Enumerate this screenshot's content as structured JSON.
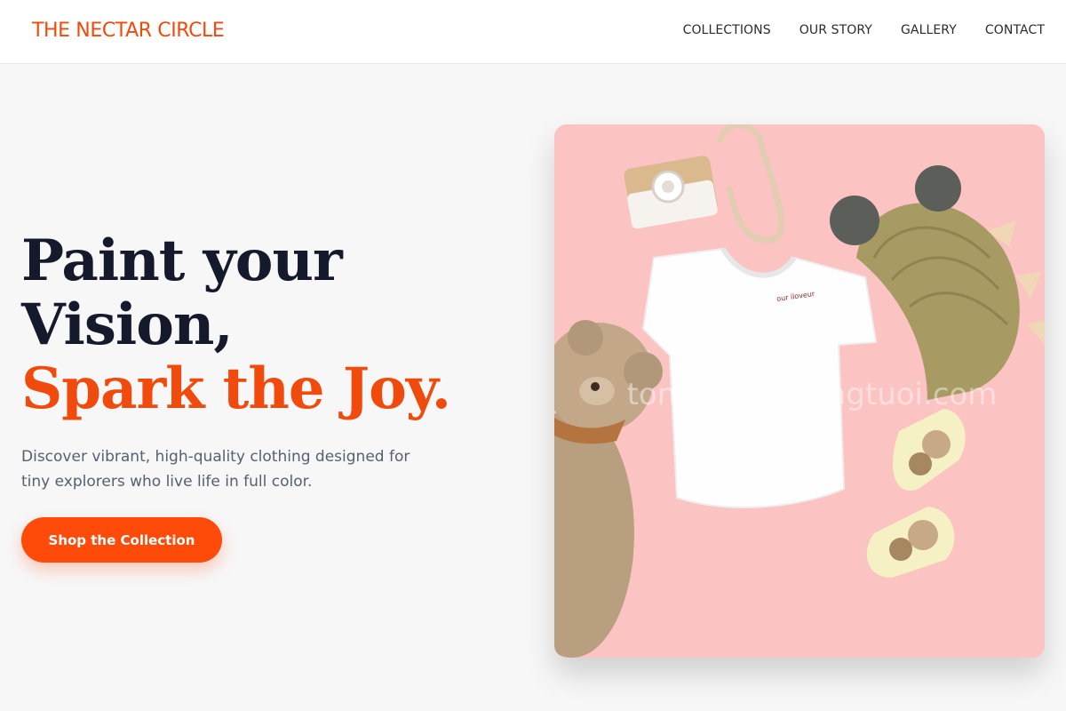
{
  "brand": {
    "name": "THE NECTAR CIRCLE",
    "accent_color": "#f04a0c"
  },
  "nav": {
    "items": [
      {
        "label": "COLLECTIONS"
      },
      {
        "label": "OUR STORY"
      },
      {
        "label": "GALLERY"
      },
      {
        "label": "CONTACT"
      }
    ]
  },
  "hero": {
    "title_line1": "Paint your",
    "title_line2": "Vision,",
    "title_accent": "Spark the Joy.",
    "subtitle": "Discover vibrant, high-quality clothing designed for tiny explorers who live life in full color.",
    "cta_label": "Shop the Collection",
    "cta_color": "#ff4b0a",
    "title_color": "#141a2b"
  },
  "image": {
    "background_color": "#fbc3c2",
    "tshirt_label_text": "our iloveur",
    "watermark_text": "tonnyhunhaongtuoi.com"
  }
}
